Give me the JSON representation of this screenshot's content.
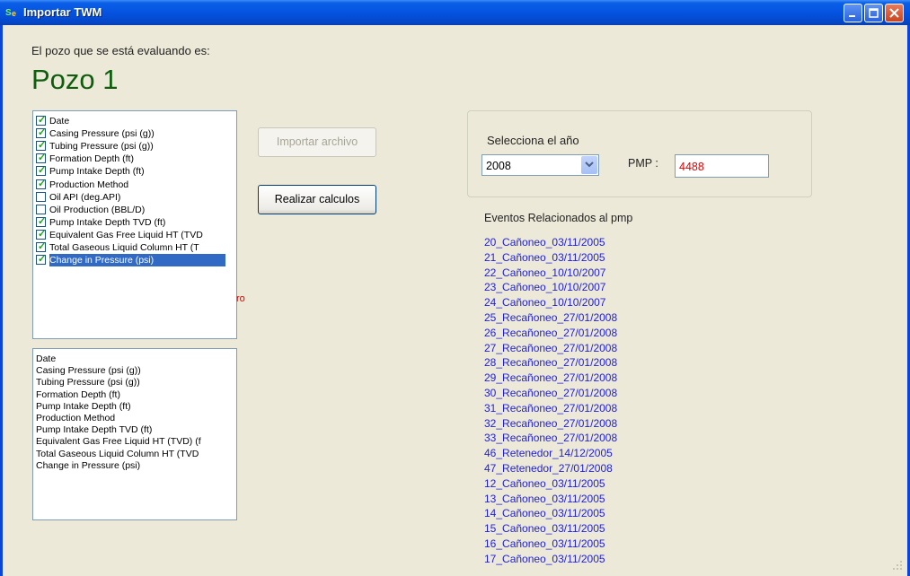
{
  "window": {
    "title": "Importar TWM",
    "icon": "se-app-icon"
  },
  "header": {
    "label": "El pozo que se está evaluando es:",
    "well_name": "Pozo 1"
  },
  "columns_checklist": [
    {
      "label": "Date",
      "checked": true,
      "selected": false
    },
    {
      "label": "Casing Pressure (psi (g))",
      "checked": true,
      "selected": false
    },
    {
      "label": "Tubing Pressure (psi (g))",
      "checked": true,
      "selected": false
    },
    {
      "label": "Formation Depth (ft)",
      "checked": true,
      "selected": false
    },
    {
      "label": "Pump Intake Depth (ft)",
      "checked": true,
      "selected": false
    },
    {
      "label": "Production Method",
      "checked": true,
      "selected": false
    },
    {
      "label": "Oil API (deg.API)",
      "checked": false,
      "selected": false
    },
    {
      "label": "Oil Production (BBL/D)",
      "checked": false,
      "selected": false
    },
    {
      "label": "Pump Intake Depth TVD (ft)",
      "checked": true,
      "selected": false
    },
    {
      "label": "Equivalent Gas Free Liquid HT (TVD",
      "checked": true,
      "selected": false
    },
    {
      "label": "Total Gaseous Liquid Column HT (T",
      "checked": true,
      "selected": false
    },
    {
      "label": "Change in Pressure (psi)",
      "checked": true,
      "selected": true
    }
  ],
  "overflow_label": "ro",
  "selected_columns": [
    "Date",
    "Casing Pressure (psi (g))",
    "Tubing Pressure (psi (g))",
    "Formation Depth (ft)",
    "Pump Intake Depth (ft)",
    "Production Method",
    "Pump Intake Depth TVD (ft)",
    "Equivalent Gas Free Liquid HT (TVD) (f",
    "Total Gaseous Liquid Column HT (TVD",
    "Change in Pressure (psi)"
  ],
  "buttons": {
    "import": "Importar archivo",
    "calculate": "Realizar calculos"
  },
  "year": {
    "label": "Selecciona el año",
    "value": "2008"
  },
  "pmp": {
    "label": "PMP :",
    "value": "4488"
  },
  "events": {
    "title": "Eventos Relacionados al pmp",
    "items": [
      "20_Cañoneo_03/11/2005",
      "21_Cañoneo_03/11/2005",
      "22_Cañoneo_10/10/2007",
      "23_Cañoneo_10/10/2007",
      "24_Cañoneo_10/10/2007",
      "25_Recañoneo_27/01/2008",
      "26_Recañoneo_27/01/2008",
      "27_Recañoneo_27/01/2008",
      "28_Recañoneo_27/01/2008",
      "29_Recañoneo_27/01/2008",
      "30_Recañoneo_27/01/2008",
      "31_Recañoneo_27/01/2008",
      "32_Recañoneo_27/01/2008",
      "33_Recañoneo_27/01/2008",
      "46_Retenedor_14/12/2005",
      "47_Retenedor_27/01/2008",
      "12_Cañoneo_03/11/2005",
      "13_Cañoneo_03/11/2005",
      "14_Cañoneo_03/11/2005",
      "15_Cañoneo_03/11/2005",
      "16_Cañoneo_03/11/2005",
      "17_Cañoneo_03/11/2005"
    ]
  },
  "colors": {
    "titlebar": "#0553E1",
    "well_name": "#0E5E0E",
    "pmp_value": "#E00000",
    "event_link": "#1E1EDC",
    "selection": "#316AC5"
  }
}
